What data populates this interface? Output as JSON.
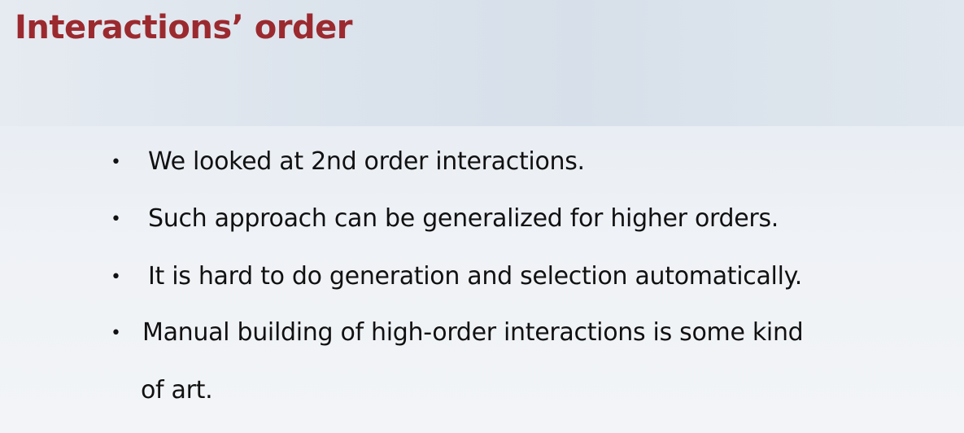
{
  "slide": {
    "title": "Interactions’ order",
    "bullets": [
      {
        "text": "We looked at 2nd order interactions."
      },
      {
        "text": "Such approach can be generalized for higher orders."
      },
      {
        "text": "It is hard to do generation and selection automatically."
      },
      {
        "text": "Manual building of high-order interactions is some kind",
        "continuation": "of art."
      }
    ]
  },
  "colors": {
    "title": "#9b2a2f",
    "text": "#111111",
    "background": "#eef1f5"
  }
}
